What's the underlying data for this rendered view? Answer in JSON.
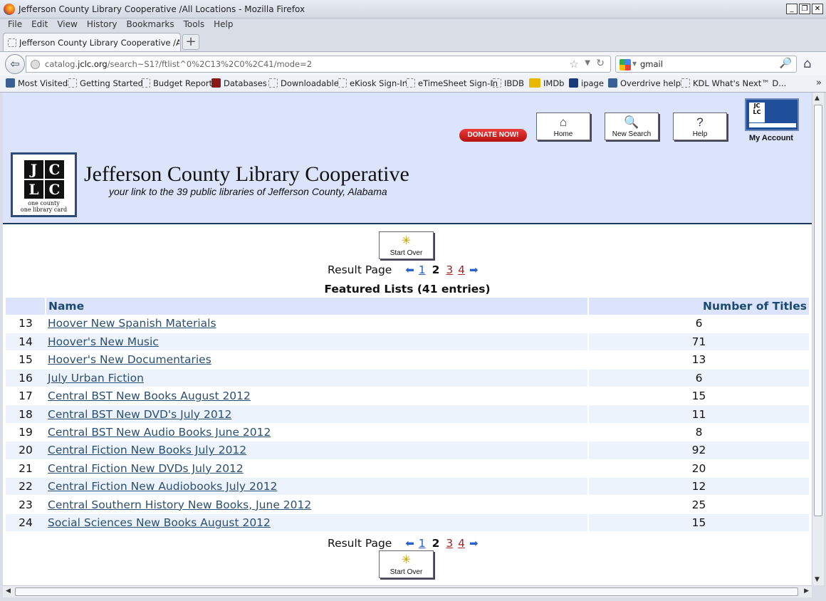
{
  "window": {
    "title": "Jefferson County Library Cooperative /All Locations - Mozilla Firefox"
  },
  "menu": [
    "File",
    "Edit",
    "View",
    "History",
    "Bookmarks",
    "Tools",
    "Help"
  ],
  "tab": {
    "label": "Jefferson County Library Cooperative /All Lo..."
  },
  "nav": {
    "url_prefix": "catalog.",
    "url_domain": "jclc.org",
    "url_rest": "/search~S1?/ftlist^0%2C13%2C0%2C41/mode=2",
    "search_value": "gmail"
  },
  "bookmarks": [
    "Most Visited",
    "Getting Started",
    "Budget Report",
    "Databases",
    "Downloadable",
    "eKiosk Sign-In",
    "eTimeSheet Sign-In",
    "IBDB",
    "IMDb",
    "ipage",
    "Overdrive help",
    "KDL What's Next™ D..."
  ],
  "header": {
    "logo_letters": [
      "J",
      "C",
      "L",
      "C"
    ],
    "logo_caption_1": "one county",
    "logo_caption_2": "one library card",
    "title": "Jefferson County Library Cooperative",
    "tagline": "your link to the 39 public libraries of Jefferson County, Alabama",
    "donate": "DONATE NOW!",
    "home": "Home",
    "new_search": "New Search",
    "help": "Help",
    "my_account": "My Account"
  },
  "start_over": "Start Over",
  "result_page": {
    "label": "Result Page",
    "pages": [
      "1",
      "2",
      "3",
      "4"
    ],
    "current": "2"
  },
  "list_title": "Featured Lists (41 entries)",
  "columns": {
    "name": "Name",
    "count": "Number of Titles"
  },
  "rows": [
    {
      "idx": "13",
      "name": "Hoover New Spanish Materials",
      "count": "6"
    },
    {
      "idx": "14",
      "name": "Hoover's New Music",
      "count": "71"
    },
    {
      "idx": "15",
      "name": "Hoover's New Documentaries",
      "count": "13"
    },
    {
      "idx": "16",
      "name": "July Urban Fiction",
      "count": "6"
    },
    {
      "idx": "17",
      "name": "Central BST New Books August 2012",
      "count": "15"
    },
    {
      "idx": "18",
      "name": "Central BST New DVD's July 2012",
      "count": "11"
    },
    {
      "idx": "19",
      "name": "Central BST New Audio Books June 2012",
      "count": "8"
    },
    {
      "idx": "20",
      "name": "Central Fiction New Books July 2012",
      "count": "92"
    },
    {
      "idx": "21",
      "name": "Central Fiction New DVDs July 2012",
      "count": "20"
    },
    {
      "idx": "22",
      "name": "Central Fiction New Audiobooks July 2012",
      "count": "12"
    },
    {
      "idx": "23",
      "name": "Central Southern History New Books, June 2012",
      "count": "25"
    },
    {
      "idx": "24",
      "name": "Social Sciences New Books August 2012",
      "count": "15"
    }
  ]
}
